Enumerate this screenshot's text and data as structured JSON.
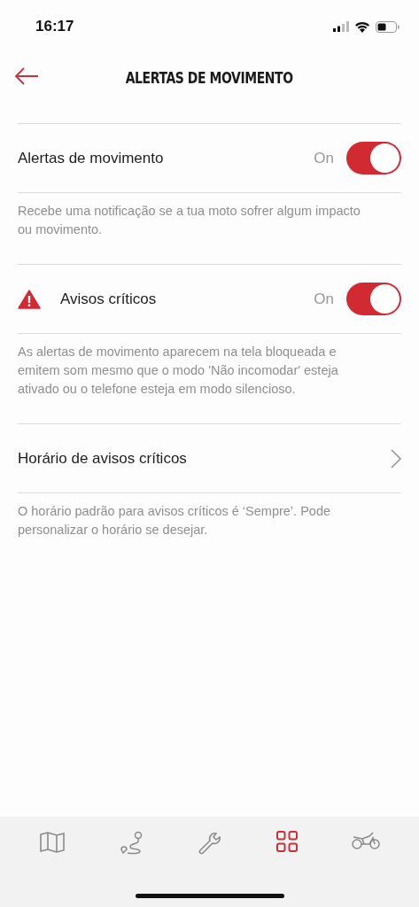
{
  "status_bar": {
    "time": "16:17"
  },
  "header": {
    "title": "ALERTAS DE MOVIMENTO"
  },
  "sections": [
    {
      "kind": "toggle",
      "label": "Alertas de movimento",
      "warning": false,
      "state_text": "On",
      "on": true,
      "description": "Recebe uma notificação se a tua moto sofrer algum impacto ou movimento."
    },
    {
      "kind": "toggle",
      "label": "Avisos críticos",
      "warning": true,
      "state_text": "On",
      "on": true,
      "description": "As alertas de movimento aparecem na tela bloqueada e emitem som mesmo que o modo 'Não incomodar' esteja ativado ou o telefone esteja em modo silencioso."
    },
    {
      "kind": "link",
      "label": "Horário de avisos críticos",
      "warning": false,
      "description": "O horário padrão para avisos críticos é ‘Sempre’. Pode personalizar o horário se desejar."
    }
  ],
  "tab_bar": [
    {
      "kind": "map",
      "selected": false
    },
    {
      "kind": "route",
      "selected": false
    },
    {
      "kind": "wrench",
      "selected": false
    },
    {
      "kind": "grid",
      "selected": true
    },
    {
      "kind": "motorcycle",
      "selected": false
    }
  ]
}
